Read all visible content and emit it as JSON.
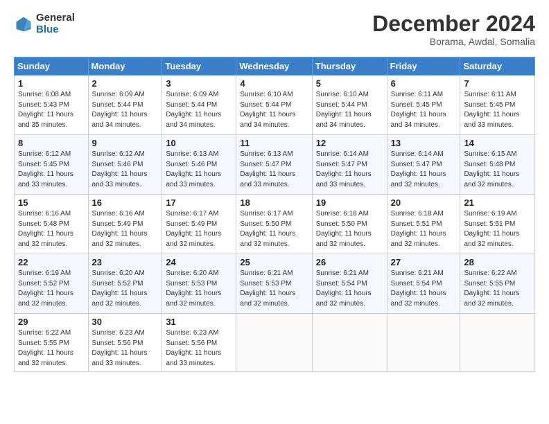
{
  "header": {
    "logo_line1": "General",
    "logo_line2": "Blue",
    "month": "December 2024",
    "location": "Borama, Awdal, Somalia"
  },
  "weekdays": [
    "Sunday",
    "Monday",
    "Tuesday",
    "Wednesday",
    "Thursday",
    "Friday",
    "Saturday"
  ],
  "weeks": [
    [
      {
        "day": "1",
        "sunrise": "6:08 AM",
        "sunset": "5:43 PM",
        "daylight": "11 hours and 35 minutes."
      },
      {
        "day": "2",
        "sunrise": "6:09 AM",
        "sunset": "5:44 PM",
        "daylight": "11 hours and 34 minutes."
      },
      {
        "day": "3",
        "sunrise": "6:09 AM",
        "sunset": "5:44 PM",
        "daylight": "11 hours and 34 minutes."
      },
      {
        "day": "4",
        "sunrise": "6:10 AM",
        "sunset": "5:44 PM",
        "daylight": "11 hours and 34 minutes."
      },
      {
        "day": "5",
        "sunrise": "6:10 AM",
        "sunset": "5:44 PM",
        "daylight": "11 hours and 34 minutes."
      },
      {
        "day": "6",
        "sunrise": "6:11 AM",
        "sunset": "5:45 PM",
        "daylight": "11 hours and 34 minutes."
      },
      {
        "day": "7",
        "sunrise": "6:11 AM",
        "sunset": "5:45 PM",
        "daylight": "11 hours and 33 minutes."
      }
    ],
    [
      {
        "day": "8",
        "sunrise": "6:12 AM",
        "sunset": "5:45 PM",
        "daylight": "11 hours and 33 minutes."
      },
      {
        "day": "9",
        "sunrise": "6:12 AM",
        "sunset": "5:46 PM",
        "daylight": "11 hours and 33 minutes."
      },
      {
        "day": "10",
        "sunrise": "6:13 AM",
        "sunset": "5:46 PM",
        "daylight": "11 hours and 33 minutes."
      },
      {
        "day": "11",
        "sunrise": "6:13 AM",
        "sunset": "5:47 PM",
        "daylight": "11 hours and 33 minutes."
      },
      {
        "day": "12",
        "sunrise": "6:14 AM",
        "sunset": "5:47 PM",
        "daylight": "11 hours and 33 minutes."
      },
      {
        "day": "13",
        "sunrise": "6:14 AM",
        "sunset": "5:47 PM",
        "daylight": "11 hours and 32 minutes."
      },
      {
        "day": "14",
        "sunrise": "6:15 AM",
        "sunset": "5:48 PM",
        "daylight": "11 hours and 32 minutes."
      }
    ],
    [
      {
        "day": "15",
        "sunrise": "6:16 AM",
        "sunset": "5:48 PM",
        "daylight": "11 hours and 32 minutes."
      },
      {
        "day": "16",
        "sunrise": "6:16 AM",
        "sunset": "5:49 PM",
        "daylight": "11 hours and 32 minutes."
      },
      {
        "day": "17",
        "sunrise": "6:17 AM",
        "sunset": "5:49 PM",
        "daylight": "11 hours and 32 minutes."
      },
      {
        "day": "18",
        "sunrise": "6:17 AM",
        "sunset": "5:50 PM",
        "daylight": "11 hours and 32 minutes."
      },
      {
        "day": "19",
        "sunrise": "6:18 AM",
        "sunset": "5:50 PM",
        "daylight": "11 hours and 32 minutes."
      },
      {
        "day": "20",
        "sunrise": "6:18 AM",
        "sunset": "5:51 PM",
        "daylight": "11 hours and 32 minutes."
      },
      {
        "day": "21",
        "sunrise": "6:19 AM",
        "sunset": "5:51 PM",
        "daylight": "11 hours and 32 minutes."
      }
    ],
    [
      {
        "day": "22",
        "sunrise": "6:19 AM",
        "sunset": "5:52 PM",
        "daylight": "11 hours and 32 minutes."
      },
      {
        "day": "23",
        "sunrise": "6:20 AM",
        "sunset": "5:52 PM",
        "daylight": "11 hours and 32 minutes."
      },
      {
        "day": "24",
        "sunrise": "6:20 AM",
        "sunset": "5:53 PM",
        "daylight": "11 hours and 32 minutes."
      },
      {
        "day": "25",
        "sunrise": "6:21 AM",
        "sunset": "5:53 PM",
        "daylight": "11 hours and 32 minutes."
      },
      {
        "day": "26",
        "sunrise": "6:21 AM",
        "sunset": "5:54 PM",
        "daylight": "11 hours and 32 minutes."
      },
      {
        "day": "27",
        "sunrise": "6:21 AM",
        "sunset": "5:54 PM",
        "daylight": "11 hours and 32 minutes."
      },
      {
        "day": "28",
        "sunrise": "6:22 AM",
        "sunset": "5:55 PM",
        "daylight": "11 hours and 32 minutes."
      }
    ],
    [
      {
        "day": "29",
        "sunrise": "6:22 AM",
        "sunset": "5:55 PM",
        "daylight": "11 hours and 32 minutes."
      },
      {
        "day": "30",
        "sunrise": "6:23 AM",
        "sunset": "5:56 PM",
        "daylight": "11 hours and 33 minutes."
      },
      {
        "day": "31",
        "sunrise": "6:23 AM",
        "sunset": "5:56 PM",
        "daylight": "11 hours and 33 minutes."
      },
      null,
      null,
      null,
      null
    ]
  ]
}
